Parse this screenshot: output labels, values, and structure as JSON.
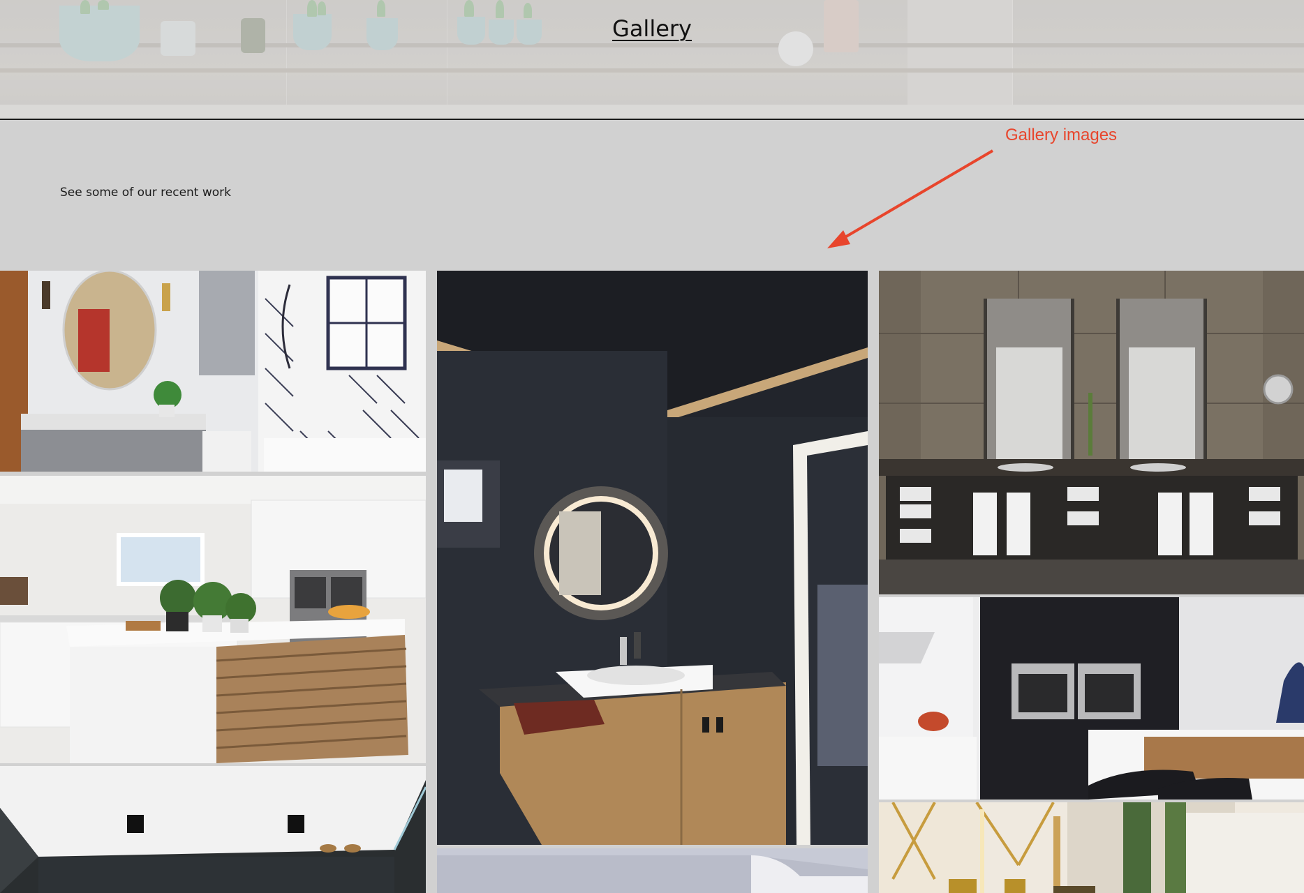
{
  "header": {
    "title": "Gallery"
  },
  "intro": {
    "text": "See some of our recent work"
  },
  "annotation": {
    "label": "Gallery images",
    "color": "#e8452c"
  },
  "gallery": {
    "images": [
      {
        "name": "bathroom-round-mirror-herringbone-tile"
      },
      {
        "name": "kitchen-island-white-wood"
      },
      {
        "name": "dark-bathroom-spotlights"
      },
      {
        "name": "black-bathroom-backlit-mirror"
      },
      {
        "name": "light-bathroom-partial"
      },
      {
        "name": "double-vanity-dark-bathroom"
      },
      {
        "name": "black-white-kitchen-ovens"
      },
      {
        "name": "gold-accent-bathroom"
      }
    ]
  }
}
